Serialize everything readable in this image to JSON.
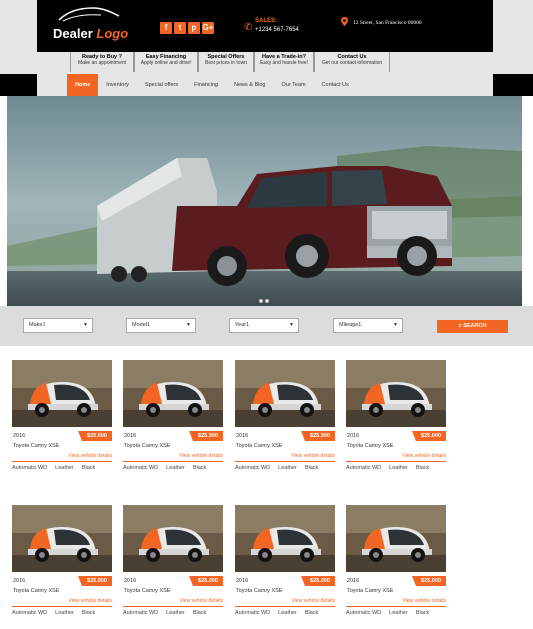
{
  "header": {
    "logo": {
      "word1": "Dealer",
      "word2": "Logo"
    },
    "socials": [
      "f",
      "t",
      "p",
      "G+"
    ],
    "sales_label": "SALES:",
    "sales_phone": "+1234 567-7654",
    "address": "12 Street, San Francisco 00000"
  },
  "quicklinks": [
    {
      "title": "Ready to Buy ?",
      "sub": "Make an appointment"
    },
    {
      "title": "Easy Financing",
      "sub": "Apply online and drive!"
    },
    {
      "title": "Special Offers",
      "sub": "Best prices in town"
    },
    {
      "title": "Have a Trade-in?",
      "sub": "Easy and hassle free!"
    },
    {
      "title": "Contact Us",
      "sub": "Get our contact information"
    }
  ],
  "nav": [
    "Home",
    "Inventory",
    "Special offers",
    "Financing",
    "News & Blog",
    "Our Team",
    "Contact Us"
  ],
  "search": {
    "make": "Make1",
    "model": "Model1",
    "year": "Year1",
    "mileage": "Mileage1",
    "button": "SEARCH"
  },
  "cards": [
    {
      "year": "2016",
      "price": "$25.000",
      "model": "Toyota Camry XSE",
      "link": "View vehicle details",
      "trans": "Automatic WD",
      "interior": "Leather",
      "color": "Black"
    },
    {
      "year": "2016",
      "price": "$25.000",
      "model": "Toyota Camry XSE",
      "link": "View vehicle details",
      "trans": "Automatic WD",
      "interior": "Leather",
      "color": "Black"
    },
    {
      "year": "2016",
      "price": "$25.000",
      "model": "Toyota Camry XSE",
      "link": "View vehicle details",
      "trans": "Automatic WD",
      "interior": "Leather",
      "color": "Black"
    },
    {
      "year": "2016",
      "price": "$25.000",
      "model": "Toyota Camry XSE",
      "link": "View vehicle details",
      "trans": "Automatic WD",
      "interior": "Leather",
      "color": "Black"
    },
    {
      "year": "2016",
      "price": "$25.000",
      "model": "Toyota Camry XSE",
      "link": "View vehicle details",
      "trans": "Automatic WD",
      "interior": "Leather",
      "color": "Black"
    },
    {
      "year": "2016",
      "price": "$25.000",
      "model": "Toyota Camry XSE",
      "link": "View vehicle details",
      "trans": "Automatic WD",
      "interior": "Leather",
      "color": "Black"
    },
    {
      "year": "2016",
      "price": "$25.000",
      "model": "Toyota Camry XSE",
      "link": "View vehicle details",
      "trans": "Automatic WD",
      "interior": "Leather",
      "color": "Black"
    },
    {
      "year": "2016",
      "price": "$25.000",
      "model": "Toyota Camry XSE",
      "link": "View vehicle details",
      "trans": "Automatic WD",
      "interior": "Leather",
      "color": "Black"
    }
  ],
  "colors": {
    "accent": "#f26522",
    "header_bg": "#000000",
    "bar_bg": "#e6e6e6"
  },
  "icons": [
    "car-logo-icon",
    "facebook-icon",
    "twitter-icon",
    "pinterest-icon",
    "google-plus-icon",
    "phone-icon",
    "map-pin-icon",
    "search-icon",
    "dropdown-caret-icon"
  ]
}
